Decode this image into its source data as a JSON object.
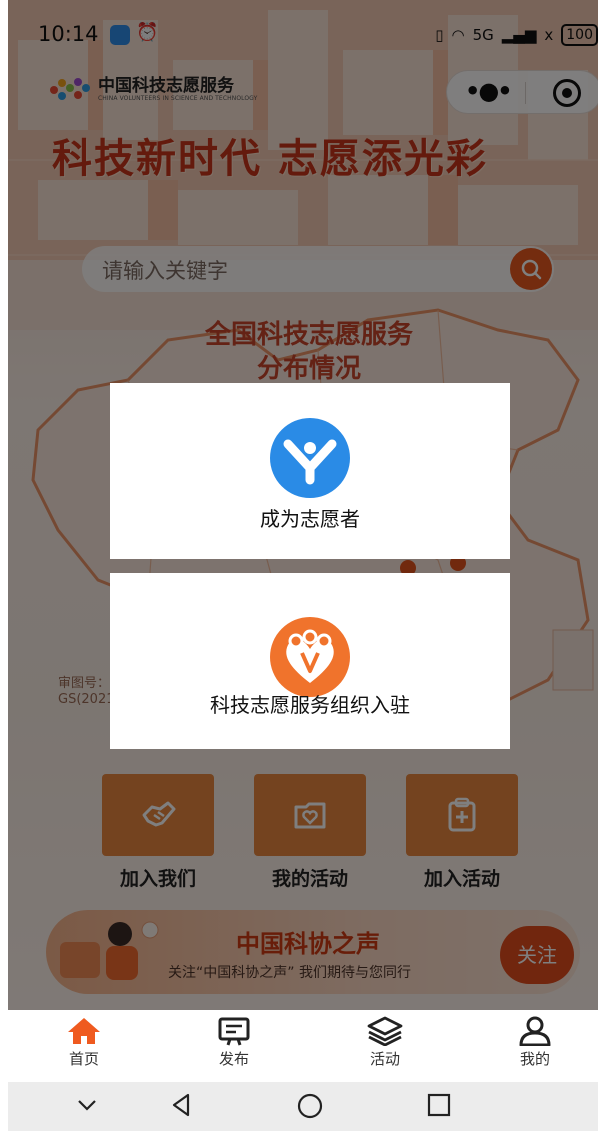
{
  "status_bar": {
    "time": "10:14",
    "network": "5G",
    "signal_secondary": "x",
    "battery": "100"
  },
  "app": {
    "logo_name": "中国科技志愿服务",
    "logo_subtitle": "CHINA VOLUNTEERS IN SCIENCE AND TECHNOLOGY",
    "headline": "科技新时代 志愿添光彩",
    "search_placeholder": "请输入关键字",
    "map_title_line1": "全国科技志愿服务",
    "map_title_line2": "分布情况",
    "approval_line1": "审图号：",
    "approval_line2": "GS(2021",
    "quick_actions": [
      {
        "label": "加入我们",
        "icon": "handshake-icon"
      },
      {
        "label": "我的活动",
        "icon": "folder-heart-icon"
      },
      {
        "label": "加入活动",
        "icon": "clipboard-plus-icon"
      }
    ],
    "banner": {
      "title": "中国科协之声",
      "subtitle": "关注“中国科协之声” 我们期待与您同行",
      "button": "关注"
    }
  },
  "modal": {
    "option_volunteer": "成为志愿者",
    "option_org": "科技志愿服务组织入驻"
  },
  "tabbar": {
    "items": [
      {
        "label": "首页",
        "icon": "home-icon",
        "active": true
      },
      {
        "label": "发布",
        "icon": "publish-icon",
        "active": false
      },
      {
        "label": "活动",
        "icon": "layers-icon",
        "active": false
      },
      {
        "label": "我的",
        "icon": "user-icon",
        "active": false
      }
    ]
  },
  "colors": {
    "accent": "#e8581f",
    "headline": "#c8341a",
    "tile": "#e8863e",
    "volunteer_icon": "#2a8be6",
    "org_icon": "#f0732c"
  }
}
